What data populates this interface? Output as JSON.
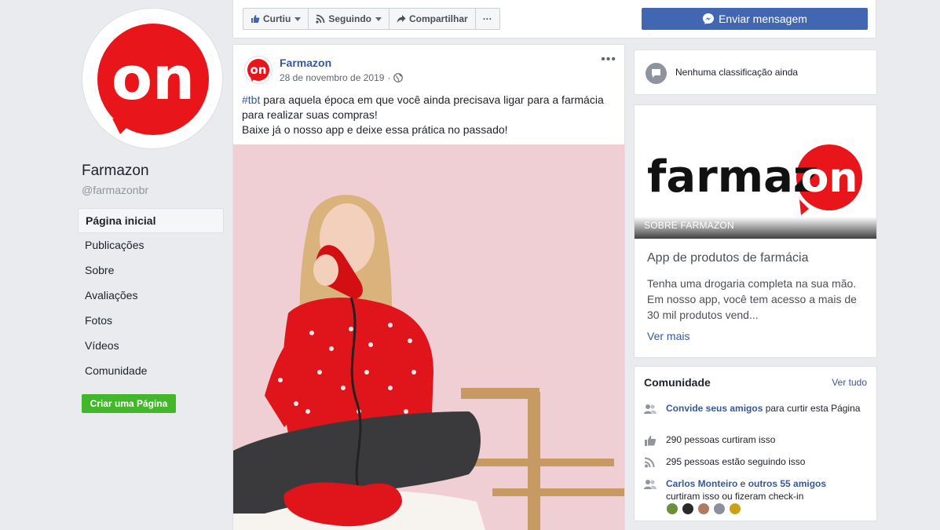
{
  "page": {
    "name": "Farmazon",
    "handle": "@farmazonbr"
  },
  "nav": {
    "items": [
      {
        "label": "Página inicial",
        "active": true
      },
      {
        "label": "Publicações"
      },
      {
        "label": "Sobre"
      },
      {
        "label": "Avaliações"
      },
      {
        "label": "Fotos"
      },
      {
        "label": "Vídeos"
      },
      {
        "label": "Comunidade"
      }
    ],
    "create_page": "Criar uma Página"
  },
  "actions": {
    "like": "Curtiu",
    "follow": "Seguindo",
    "share": "Compartilhar",
    "more": "···",
    "message": "Enviar mensagem"
  },
  "post": {
    "author": "Farmazon",
    "date": "28 de novembro de 2019",
    "more": "•••",
    "hashtag": "#tbt",
    "line1": " para aquela época em que você ainda precisava ligar para a farmácia para realizar suas compras!",
    "line2": "Baixe já o nosso app e deixe essa prática no passado!",
    "avatar_text": "on"
  },
  "sidebar": {
    "rating_text": "Nenhuma classificação ainda",
    "about": {
      "logo_text_dark": "farmaz",
      "logo_text_brand": "on",
      "cover_label": "SOBRE FARMAZON",
      "headline": "App de produtos de farmácia",
      "description": "Tenha uma drogaria completa na sua mão. Em nosso app, você tem acesso a mais de 30 mil produtos vend...",
      "see_more": "Ver mais"
    },
    "community": {
      "title": "Comunidade",
      "see_all": "Ver tudo",
      "invite_link": "Convide seus amigos",
      "invite_rest": " para curtir esta Página",
      "likes": "290 pessoas curtiram isso",
      "follows": "295 pessoas estão seguindo isso",
      "friend_name": "Carlos Monteiro",
      "friend_and": " e ",
      "friend_others": "outros 55 amigos",
      "friend_rest": "curtiram isso ou fizeram check-in"
    }
  },
  "colors": {
    "brand_red": "#e8151b",
    "facebook_blue": "#4267b2",
    "link_blue": "#385898",
    "green": "#42b72a"
  },
  "icons": [
    "like-icon",
    "rss-icon",
    "share-icon",
    "messenger-icon",
    "globe-icon",
    "rating-icon",
    "friends-icon",
    "thumb-icon"
  ]
}
